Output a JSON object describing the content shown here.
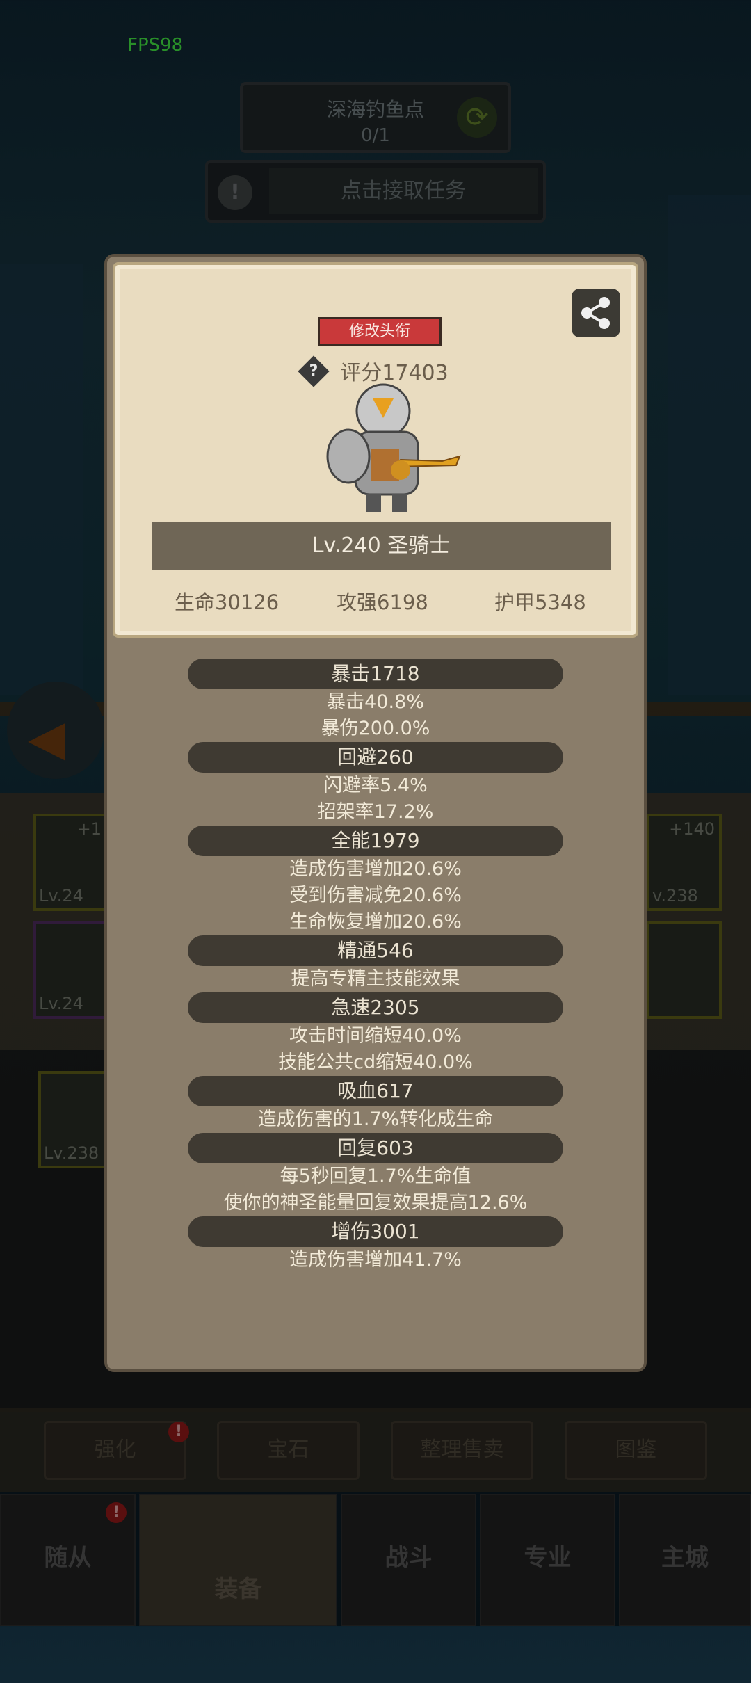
{
  "hud": {
    "fps": "FPS98"
  },
  "quest": {
    "name": "深海钓鱼点",
    "progress": "0/1"
  },
  "task": {
    "label": "点击接取任务",
    "alert_glyph": "!"
  },
  "background": {
    "slots": [
      {
        "plus": "+1",
        "level": "Lv.24"
      },
      {
        "plus": "+140",
        "level": "v.238"
      },
      {
        "plus": "",
        "level": "Lv.24"
      },
      {
        "plus": "",
        "level": "Lv.238"
      }
    ],
    "actions": [
      "强化",
      "宝石",
      "整理售卖",
      "图鉴"
    ],
    "nav": [
      "随从",
      "装备",
      "战斗",
      "专业",
      "主城"
    ],
    "alert_glyph": "!"
  },
  "profile": {
    "change_title_label": "修改头衔",
    "help_glyph": "?",
    "score": "评分17403",
    "level_class": "Lv.240 圣骑士",
    "hp": "生命30126",
    "attack": "攻强6198",
    "armor": "护甲5348"
  },
  "stats": [
    {
      "head": "暴击1718",
      "lines": [
        "暴击40.8%",
        "暴伤200.0%"
      ]
    },
    {
      "head": "回避260",
      "lines": [
        "闪避率5.4%",
        "招架率17.2%"
      ]
    },
    {
      "head": "全能1979",
      "lines": [
        "造成伤害增加20.6%",
        "受到伤害减免20.6%",
        "生命恢复增加20.6%"
      ]
    },
    {
      "head": "精通546",
      "lines": [
        "提高专精主技能效果"
      ]
    },
    {
      "head": "急速2305",
      "lines": [
        "攻击时间缩短40.0%",
        "技能公共cd缩短40.0%"
      ]
    },
    {
      "head": "吸血617",
      "lines": [
        "造成伤害的1.7%转化成生命"
      ]
    },
    {
      "head": "回复603",
      "lines": [
        "每5秒回复1.7%生命值",
        "使你的神圣能量回复效果提高12.6%"
      ]
    },
    {
      "head": "增伤3001",
      "lines": [
        "造成伤害增加41.7%"
      ]
    }
  ]
}
